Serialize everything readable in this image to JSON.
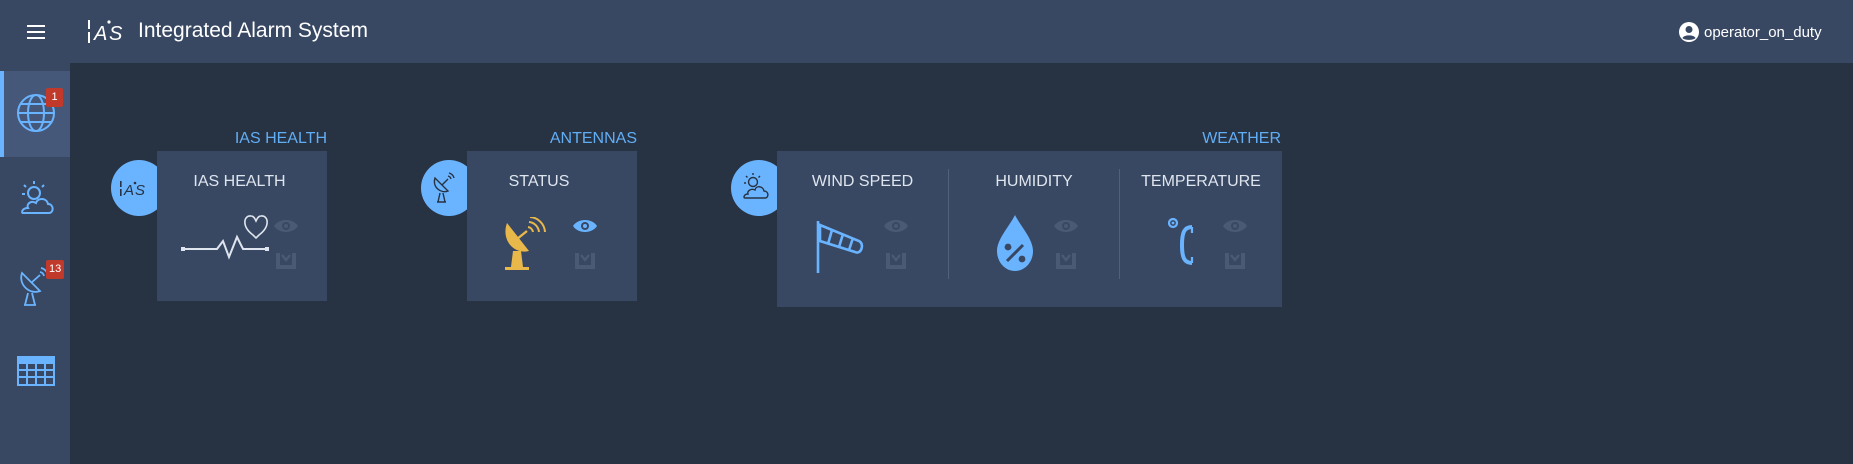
{
  "header": {
    "menu_icon": "hamburger-menu-icon",
    "logo_text": "¦A'S",
    "title": "Integrated Alarm System",
    "user_icon": "account-circle-icon",
    "user_name": "operator_on_duty"
  },
  "sidebar": {
    "items": [
      {
        "id": "overview",
        "icon": "globe-icon",
        "badge": "1",
        "active": true
      },
      {
        "id": "weather",
        "icon": "weather-cloud-sun-icon",
        "badge": "",
        "active": false
      },
      {
        "id": "antennas",
        "icon": "antenna-icon",
        "badge": "13",
        "active": false
      },
      {
        "id": "table",
        "icon": "table-grid-icon",
        "badge": "",
        "active": false
      }
    ]
  },
  "panels": {
    "ias_health": {
      "title": "IAS HEALTH",
      "bubble_text": "¦A'S",
      "cells": [
        {
          "label": "IAS HEALTH",
          "icon": "heartbeat-icon"
        }
      ]
    },
    "antennas": {
      "title": "ANTENNAS",
      "bubble_icon": "antenna-icon",
      "cells": [
        {
          "label": "STATUS",
          "icon": "antenna-dish-icon",
          "icon_color": "#e8b84a",
          "eye_active": true
        }
      ]
    },
    "weather": {
      "title": "WEATHER",
      "bubble_icon": "weather-cloud-sun-icon",
      "cells": [
        {
          "label": "WIND SPEED",
          "icon": "windsock-icon"
        },
        {
          "label": "HUMIDITY",
          "icon": "humidity-drop-icon"
        },
        {
          "label": "TEMPERATURE",
          "icon": "celsius-thermometer-icon"
        }
      ]
    }
  },
  "colors": {
    "background": "#273243",
    "bars": "#384863",
    "accent": "#6ab4ff",
    "panel_title": "#62aef5",
    "warning": "#e8b84a",
    "badge": "#c0392b"
  }
}
